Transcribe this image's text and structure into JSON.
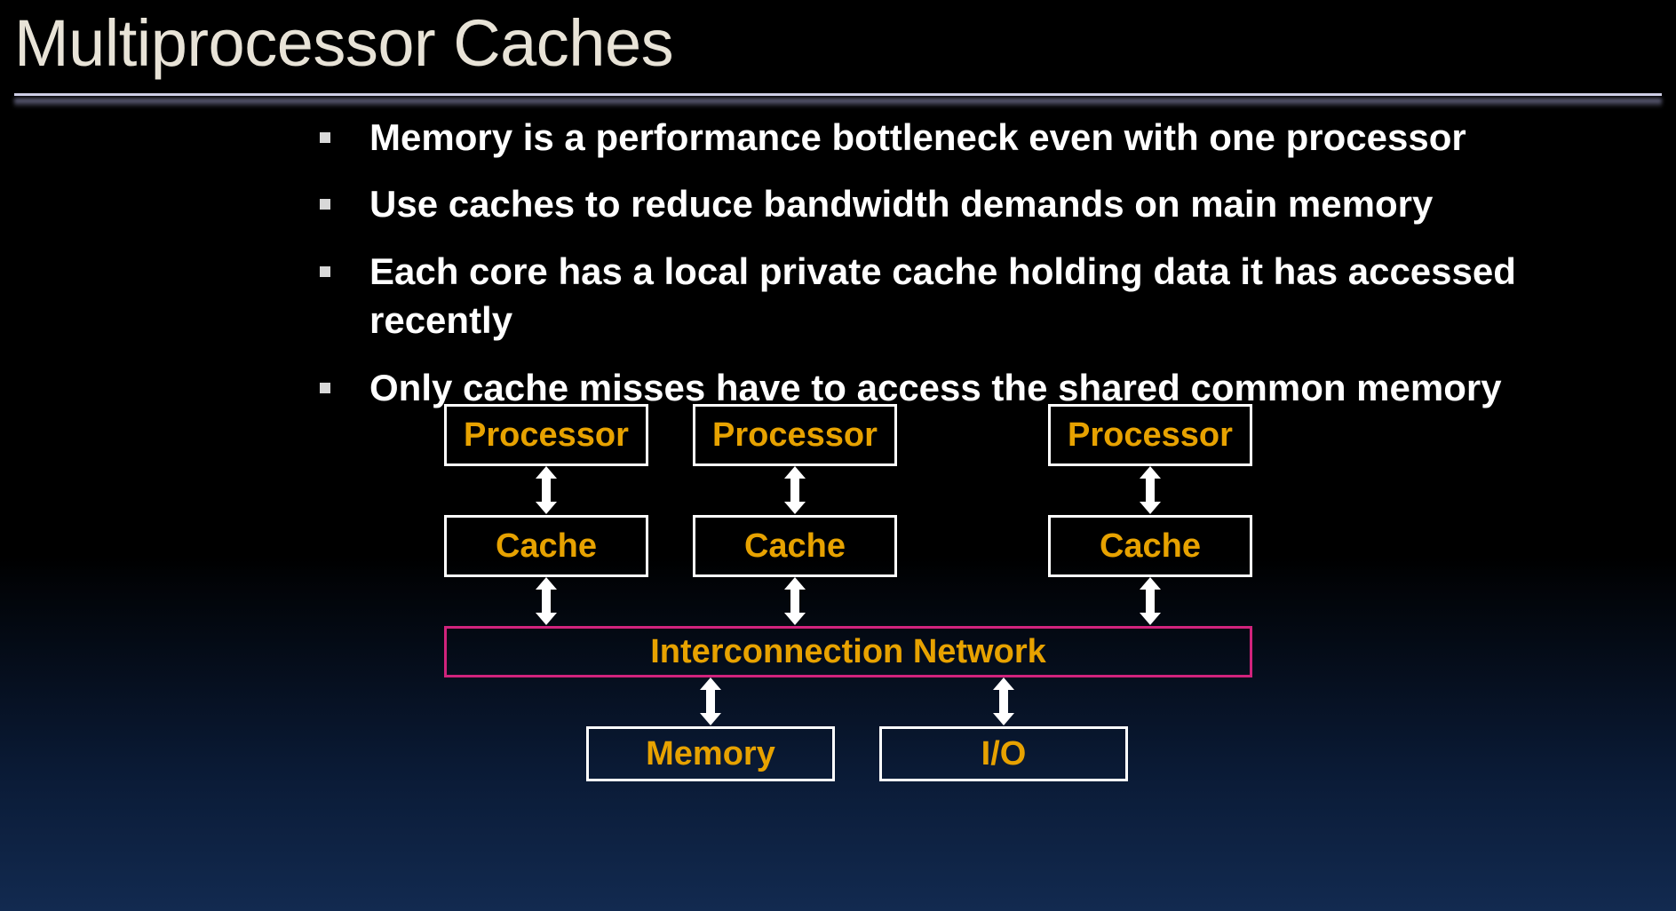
{
  "title": "Multiprocessor Caches",
  "bullets": [
    "Memory is a performance bottleneck even with one processor",
    "Use caches to reduce bandwidth demands on main memory",
    "Each core has a local private cache holding data it has accessed recently",
    "Only cache misses have to access the shared common memory"
  ],
  "diagram": {
    "processor": "Processor",
    "cache": "Cache",
    "interconnect": "Interconnection Network",
    "memory": "Memory",
    "io": "I/O"
  }
}
